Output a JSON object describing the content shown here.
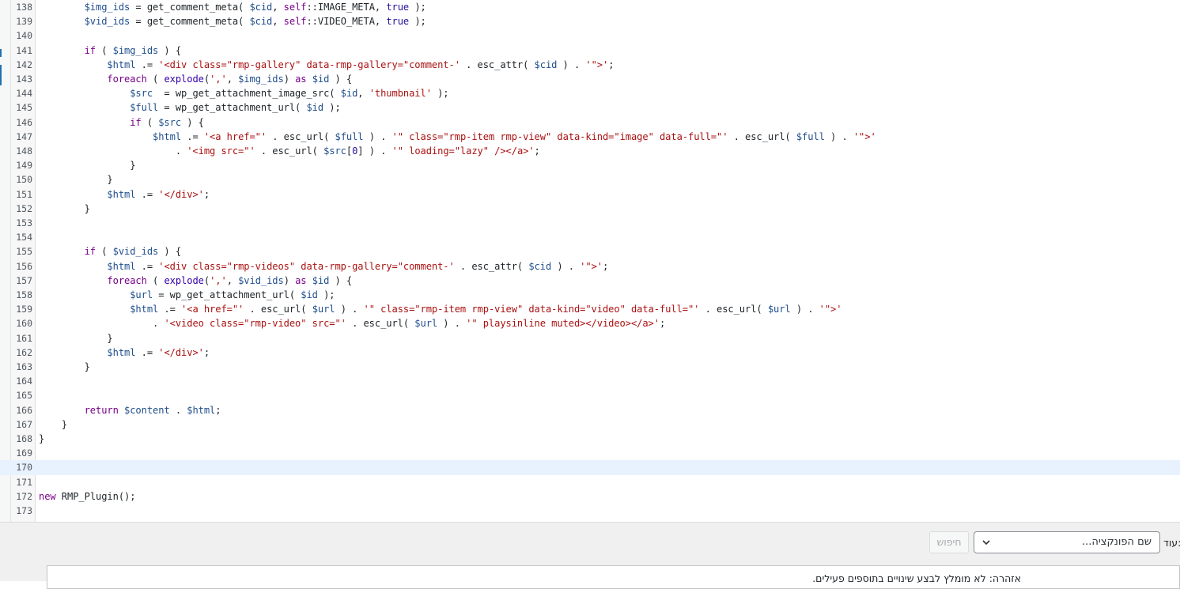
{
  "editor": {
    "active_line": "170",
    "lines": [
      {
        "n": "138",
        "t": [
          [
            "def",
            "        "
          ],
          [
            "var",
            "$img_ids"
          ],
          [
            "def",
            " = get_comment_meta( "
          ],
          [
            "var",
            "$cid"
          ],
          [
            "def",
            ", "
          ],
          [
            "kw",
            "self"
          ],
          [
            "def",
            "::IMAGE_META, "
          ],
          [
            "atom",
            "true"
          ],
          [
            "def",
            " );"
          ]
        ]
      },
      {
        "n": "139",
        "t": [
          [
            "def",
            "        "
          ],
          [
            "var",
            "$vid_ids"
          ],
          [
            "def",
            " = get_comment_meta( "
          ],
          [
            "var",
            "$cid"
          ],
          [
            "def",
            ", "
          ],
          [
            "kw",
            "self"
          ],
          [
            "def",
            "::VIDEO_META, "
          ],
          [
            "atom",
            "true"
          ],
          [
            "def",
            " );"
          ]
        ]
      },
      {
        "n": "140",
        "t": []
      },
      {
        "n": "141",
        "t": [
          [
            "def",
            "        "
          ],
          [
            "kw",
            "if"
          ],
          [
            "def",
            " ( "
          ],
          [
            "var",
            "$img_ids"
          ],
          [
            "def",
            " ) {"
          ]
        ]
      },
      {
        "n": "142",
        "t": [
          [
            "def",
            "            "
          ],
          [
            "var",
            "$html"
          ],
          [
            "def",
            " .= "
          ],
          [
            "str",
            "'<div class=\"rmp-gallery\" data-rmp-gallery=\"comment-'"
          ],
          [
            "def",
            " . esc_attr( "
          ],
          [
            "var",
            "$cid"
          ],
          [
            "def",
            " ) . "
          ],
          [
            "str",
            "'\">'"
          ],
          [
            "def",
            ";"
          ]
        ]
      },
      {
        "n": "143",
        "t": [
          [
            "def",
            "            "
          ],
          [
            "kw",
            "foreach"
          ],
          [
            "def",
            " ( "
          ],
          [
            "bi",
            "explode"
          ],
          [
            "def",
            "("
          ],
          [
            "str",
            "','"
          ],
          [
            "def",
            ", "
          ],
          [
            "var",
            "$img_ids"
          ],
          [
            "def",
            ") "
          ],
          [
            "kw",
            "as"
          ],
          [
            "def",
            " "
          ],
          [
            "var",
            "$id"
          ],
          [
            "def",
            " ) {"
          ]
        ]
      },
      {
        "n": "144",
        "t": [
          [
            "def",
            "                "
          ],
          [
            "var",
            "$src"
          ],
          [
            "def",
            "  = wp_get_attachment_image_src( "
          ],
          [
            "var",
            "$id"
          ],
          [
            "def",
            ", "
          ],
          [
            "str",
            "'thumbnail'"
          ],
          [
            "def",
            " );"
          ]
        ]
      },
      {
        "n": "145",
        "t": [
          [
            "def",
            "                "
          ],
          [
            "var",
            "$full"
          ],
          [
            "def",
            " = wp_get_attachment_url( "
          ],
          [
            "var",
            "$id"
          ],
          [
            "def",
            " );"
          ]
        ]
      },
      {
        "n": "146",
        "t": [
          [
            "def",
            "                "
          ],
          [
            "kw",
            "if"
          ],
          [
            "def",
            " ( "
          ],
          [
            "var",
            "$src"
          ],
          [
            "def",
            " ) {"
          ]
        ]
      },
      {
        "n": "147",
        "t": [
          [
            "def",
            "                    "
          ],
          [
            "var",
            "$html"
          ],
          [
            "def",
            " .= "
          ],
          [
            "str",
            "'<a href=\"'"
          ],
          [
            "def",
            " . esc_url( "
          ],
          [
            "var",
            "$full"
          ],
          [
            "def",
            " ) . "
          ],
          [
            "str",
            "'\" class=\"rmp-item rmp-view\" data-kind=\"image\" data-full=\"'"
          ],
          [
            "def",
            " . esc_url( "
          ],
          [
            "var",
            "$full"
          ],
          [
            "def",
            " ) . "
          ],
          [
            "str",
            "'\">'"
          ]
        ]
      },
      {
        "n": "148",
        "t": [
          [
            "def",
            "                        . "
          ],
          [
            "str",
            "'<img src=\"'"
          ],
          [
            "def",
            " . esc_url( "
          ],
          [
            "var",
            "$src"
          ],
          [
            "def",
            "["
          ],
          [
            "atom",
            "0"
          ],
          [
            "def",
            "] ) . "
          ],
          [
            "str",
            "'\" loading=\"lazy\" /></a>'"
          ],
          [
            "def",
            ";"
          ]
        ]
      },
      {
        "n": "149",
        "t": [
          [
            "def",
            "                }"
          ]
        ]
      },
      {
        "n": "150",
        "t": [
          [
            "def",
            "            }"
          ]
        ]
      },
      {
        "n": "151",
        "t": [
          [
            "def",
            "            "
          ],
          [
            "var",
            "$html"
          ],
          [
            "def",
            " .= "
          ],
          [
            "str",
            "'</div>'"
          ],
          [
            "def",
            ";"
          ]
        ]
      },
      {
        "n": "152",
        "t": [
          [
            "def",
            "        }"
          ]
        ]
      },
      {
        "n": "153",
        "t": []
      },
      {
        "n": "154",
        "t": []
      },
      {
        "n": "155",
        "t": [
          [
            "def",
            "        "
          ],
          [
            "kw",
            "if"
          ],
          [
            "def",
            " ( "
          ],
          [
            "var",
            "$vid_ids"
          ],
          [
            "def",
            " ) {"
          ]
        ]
      },
      {
        "n": "156",
        "t": [
          [
            "def",
            "            "
          ],
          [
            "var",
            "$html"
          ],
          [
            "def",
            " .= "
          ],
          [
            "str",
            "'<div class=\"rmp-videos\" data-rmp-gallery=\"comment-'"
          ],
          [
            "def",
            " . esc_attr( "
          ],
          [
            "var",
            "$cid"
          ],
          [
            "def",
            " ) . "
          ],
          [
            "str",
            "'\">'"
          ],
          [
            "def",
            ";"
          ]
        ]
      },
      {
        "n": "157",
        "t": [
          [
            "def",
            "            "
          ],
          [
            "kw",
            "foreach"
          ],
          [
            "def",
            " ( "
          ],
          [
            "bi",
            "explode"
          ],
          [
            "def",
            "("
          ],
          [
            "str",
            "','"
          ],
          [
            "def",
            ", "
          ],
          [
            "var",
            "$vid_ids"
          ],
          [
            "def",
            ") "
          ],
          [
            "kw",
            "as"
          ],
          [
            "def",
            " "
          ],
          [
            "var",
            "$id"
          ],
          [
            "def",
            " ) {"
          ]
        ]
      },
      {
        "n": "158",
        "t": [
          [
            "def",
            "                "
          ],
          [
            "var",
            "$url"
          ],
          [
            "def",
            " = wp_get_attachment_url( "
          ],
          [
            "var",
            "$id"
          ],
          [
            "def",
            " );"
          ]
        ]
      },
      {
        "n": "159",
        "t": [
          [
            "def",
            "                "
          ],
          [
            "var",
            "$html"
          ],
          [
            "def",
            " .= "
          ],
          [
            "str",
            "'<a href=\"'"
          ],
          [
            "def",
            " . esc_url( "
          ],
          [
            "var",
            "$url"
          ],
          [
            "def",
            " ) . "
          ],
          [
            "str",
            "'\" class=\"rmp-item rmp-view\" data-kind=\"video\" data-full=\"'"
          ],
          [
            "def",
            " . esc_url( "
          ],
          [
            "var",
            "$url"
          ],
          [
            "def",
            " ) . "
          ],
          [
            "str",
            "'\">'"
          ]
        ]
      },
      {
        "n": "160",
        "t": [
          [
            "def",
            "                    . "
          ],
          [
            "str",
            "'<video class=\"rmp-video\" src=\"'"
          ],
          [
            "def",
            " . esc_url( "
          ],
          [
            "var",
            "$url"
          ],
          [
            "def",
            " ) . "
          ],
          [
            "str",
            "'\" playsinline muted></video></a>'"
          ],
          [
            "def",
            ";"
          ]
        ]
      },
      {
        "n": "161",
        "t": [
          [
            "def",
            "            }"
          ]
        ]
      },
      {
        "n": "162",
        "t": [
          [
            "def",
            "            "
          ],
          [
            "var",
            "$html"
          ],
          [
            "def",
            " .= "
          ],
          [
            "str",
            "'</div>'"
          ],
          [
            "def",
            ";"
          ]
        ]
      },
      {
        "n": "163",
        "t": [
          [
            "def",
            "        }"
          ]
        ]
      },
      {
        "n": "164",
        "t": []
      },
      {
        "n": "165",
        "t": []
      },
      {
        "n": "166",
        "t": [
          [
            "def",
            "        "
          ],
          [
            "kw",
            "return"
          ],
          [
            "def",
            " "
          ],
          [
            "var",
            "$content"
          ],
          [
            "def",
            " . "
          ],
          [
            "var",
            "$html"
          ],
          [
            "def",
            ";"
          ]
        ]
      },
      {
        "n": "167",
        "t": [
          [
            "def",
            "    }"
          ]
        ]
      },
      {
        "n": "168",
        "t": [
          [
            "def",
            "}"
          ]
        ]
      },
      {
        "n": "169",
        "t": []
      },
      {
        "n": "170",
        "t": []
      },
      {
        "n": "171",
        "t": []
      },
      {
        "n": "172",
        "t": [
          [
            "kw",
            "new"
          ],
          [
            "def",
            " RMP_Plugin();"
          ]
        ]
      },
      {
        "n": "173",
        "t": []
      }
    ]
  },
  "toolbar": {
    "label": "עוד:",
    "function_select_value": "שם הפונקציה...",
    "search_button": "חיפוש",
    "chevron_icon": "chevron-down-icon"
  },
  "notice": {
    "text": "אזהרה: לא מומלץ לבצע שינויים בתוספים פעילים."
  },
  "colors": {
    "keyword": "#770088",
    "variable": "#1f4e8c",
    "string": "#aa1111",
    "atom": "#221199",
    "active_line_bg": "#e8f2fe"
  }
}
